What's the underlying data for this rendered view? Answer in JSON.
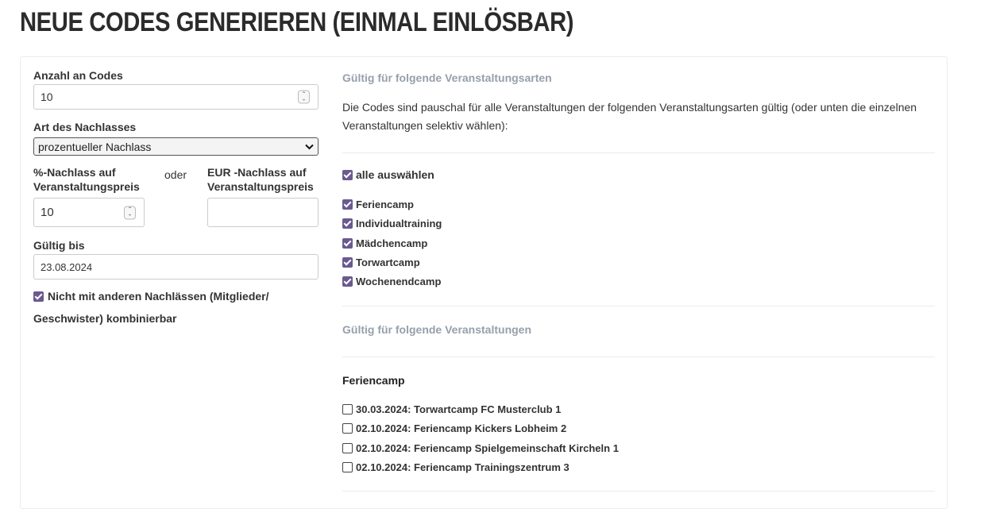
{
  "title": "NEUE CODES GENERIEREN (EINMAL EINLÖSBAR)",
  "left": {
    "count_label": "Anzahl an Codes",
    "count_value": "10",
    "discount_type_label": "Art des Nachlasses",
    "discount_type_value": "prozentueller Nachlass",
    "percent_label_line1": "%-Nachlass auf",
    "percent_label_line2": "Veranstaltungspreis",
    "or_label": "oder",
    "eur_label_line1": "EUR -Nachlass auf",
    "eur_label_line2": "Veranstaltungspreis",
    "percent_value": "10",
    "eur_value": "",
    "valid_until_label": "Gültig bis",
    "valid_until_value": "23.08.2024",
    "no_combine_line1": "Nicht mit anderen Nachlässen (Mitglieder/",
    "no_combine_line2": "Geschwister) kombinierbar",
    "no_combine_checked": true
  },
  "right": {
    "types_heading": "Gültig für folgende Veranstaltungsarten",
    "types_desc_line1": "Die Codes sind pauschal für alle Veranstaltungen der folgenden Veranstaltungsarten gültig (oder unten die einzelnen",
    "types_desc_line2": "Veranstaltungen selektiv wählen):",
    "select_all_label": "alle auswählen",
    "types": [
      {
        "label": "Feriencamp",
        "checked": true
      },
      {
        "label": "Individualtraining",
        "checked": true
      },
      {
        "label": "Mädchencamp",
        "checked": true
      },
      {
        "label": "Torwartcamp",
        "checked": true
      },
      {
        "label": "Wochenendcamp",
        "checked": true
      }
    ],
    "events_heading": "Gültig für folgende Veranstaltungen",
    "group_title": "Feriencamp",
    "events": [
      {
        "label": "30.03.2024: Torwartcamp FC Musterclub 1",
        "checked": false
      },
      {
        "label": "02.10.2024: Feriencamp Kickers Lobheim 2",
        "checked": false
      },
      {
        "label": "02.10.2024: Feriencamp Spielgemeinschaft Kircheln 1",
        "checked": false
      },
      {
        "label": "02.10.2024: Feriencamp Trainingszentrum 3",
        "checked": false
      }
    ]
  },
  "colors": {
    "checkbox": "#6a5a8f",
    "section_heading": "#96a0ab"
  }
}
